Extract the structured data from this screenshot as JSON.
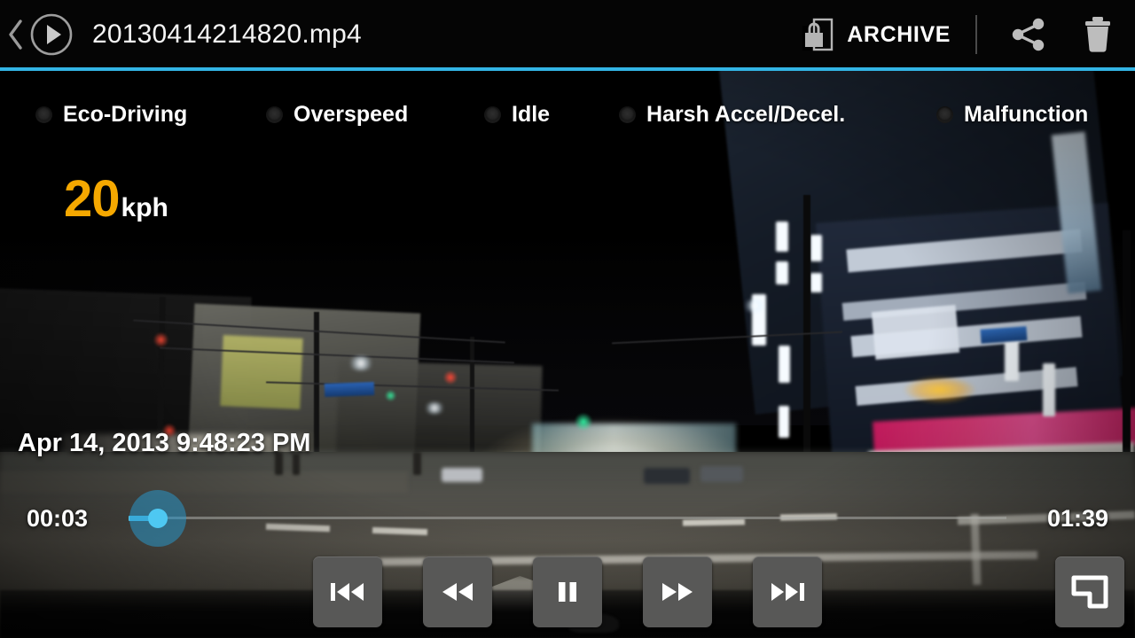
{
  "header": {
    "back_icon": "chevron-left-icon",
    "play_icon": "play-circle-icon",
    "title": "20130414214820.mp4",
    "archive_label": "ARCHIVE",
    "archive_icon": "lock-archive-icon",
    "share_icon": "share-icon",
    "delete_icon": "trash-icon",
    "accent_color": "#33b5e5"
  },
  "indicators": [
    {
      "label": "Eco-Driving",
      "active": false,
      "led_color": "#242424"
    },
    {
      "label": "Overspeed",
      "active": false,
      "led_color": "#242424"
    },
    {
      "label": "Idle",
      "active": false,
      "led_color": "#242424"
    },
    {
      "label": "Harsh Accel/Decel.",
      "active": false,
      "led_color": "#242424"
    },
    {
      "label": "Malfunction",
      "active": false,
      "led_color": "#242424"
    }
  ],
  "speed": {
    "value": "20",
    "unit": "kph",
    "value_color": "#f5a800",
    "unit_color": "#ffffff"
  },
  "timestamp": "Apr 14, 2013 9:48:23 PM",
  "seek": {
    "current_time": "00:03",
    "total_time": "01:39",
    "progress_percent": 3,
    "fill_color": "#4ec6ef",
    "thumb_color": "#4ec8f2"
  },
  "controls": [
    {
      "name": "skip-previous-button",
      "icon": "skip-previous-icon"
    },
    {
      "name": "rewind-button",
      "icon": "rewind-icon"
    },
    {
      "name": "pause-button",
      "icon": "pause-icon"
    },
    {
      "name": "fast-forward-button",
      "icon": "fast-forward-icon"
    },
    {
      "name": "skip-next-button",
      "icon": "skip-next-icon"
    }
  ],
  "pip": {
    "name": "pip-toggle-button",
    "icon": "pip-icon"
  }
}
